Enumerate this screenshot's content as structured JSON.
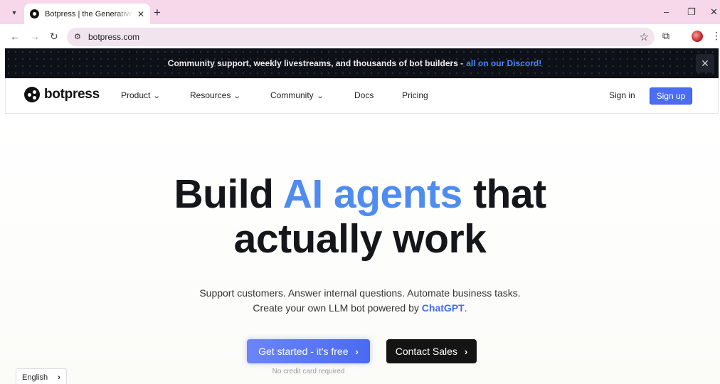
{
  "browser": {
    "tab_title": "Botpress | the Generative AI platform",
    "url": "botpress.com",
    "new_tab": "+",
    "minimize": "–",
    "restore": "❐",
    "close": "✕"
  },
  "banner": {
    "text": "Community support, weekly livestreams, and thousands of bot builders -",
    "link": "all on our Discord!",
    "close": "✕"
  },
  "nav": {
    "logo": "botpress",
    "items": [
      {
        "label": "Product",
        "dropdown": true
      },
      {
        "label": "Resources",
        "dropdown": true
      },
      {
        "label": "Community",
        "dropdown": true
      },
      {
        "label": "Docs",
        "dropdown": false
      },
      {
        "label": "Pricing",
        "dropdown": false
      }
    ],
    "sign_in": "Sign in",
    "sign_up": "Sign up"
  },
  "hero": {
    "title_pre": "Build",
    "title_accent": "AI agents",
    "title_post": "that",
    "title_line2": "actually work",
    "sub_line1": "Support customers. Answer internal questions. Automate business tasks.",
    "sub_line2_pre": "Create your own LLM bot powered by",
    "sub_line2_link": "ChatGPT",
    "sub_line2_post": ".",
    "cta_primary": "Get started - it's free",
    "cta_secondary": "Contact Sales",
    "cta_note": "No credit card required"
  },
  "language": {
    "selected": "English"
  },
  "colors": {
    "accent": "#4f8cf0",
    "primary_button": "#4b6cf5",
    "banner_bg": "#0d1117",
    "banner_link": "#4c84ff",
    "tabbar": "#f6d8ea"
  }
}
